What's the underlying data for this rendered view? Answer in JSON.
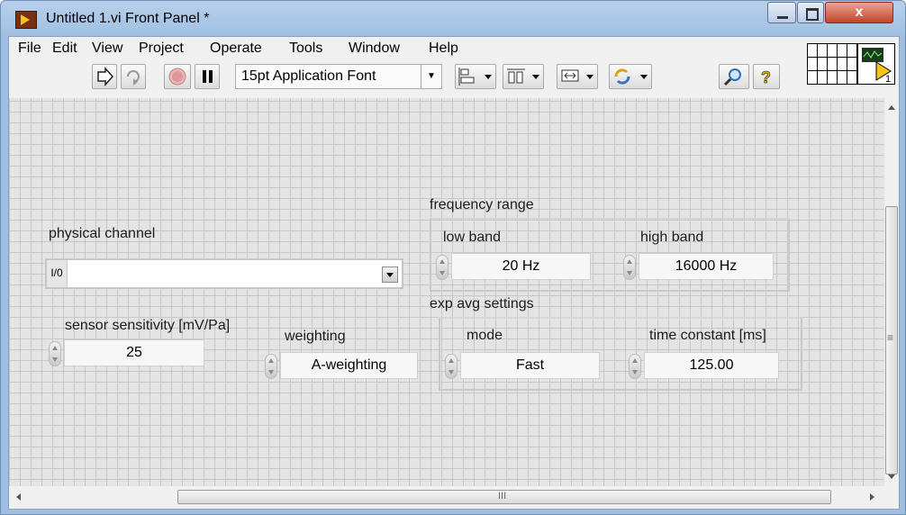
{
  "window": {
    "title": "Untitled 1.vi Front Panel *",
    "close_glyph": "x"
  },
  "menu": [
    "File",
    "Edit",
    "View",
    "Project",
    "Operate",
    "Tools",
    "Window",
    "Help"
  ],
  "toolbar": {
    "font": "15pt Application Font",
    "icons": [
      "run-arrow-icon",
      "run-continuously-icon",
      "abort-icon",
      "pause-icon",
      "align-icon",
      "distribute-icon",
      "resize-icon",
      "reorder-icon",
      "search-icon",
      "help-icon"
    ],
    "connector_number": "1"
  },
  "panel": {
    "physical_channel": {
      "label": "physical channel",
      "io_glyph": "I/0",
      "value": ""
    },
    "sensor_sensitivity": {
      "label": "sensor sensitivity [mV/Pa]",
      "value": "25"
    },
    "weighting": {
      "label": "weighting",
      "value": "A-weighting"
    },
    "frequency_range": {
      "label": "frequency range",
      "low_band": {
        "label": "low band",
        "value": "20 Hz"
      },
      "high_band": {
        "label": "high band",
        "value": "16000 Hz"
      }
    },
    "exp_avg_settings": {
      "label": "exp avg settings",
      "mode": {
        "label": "mode",
        "value": "Fast"
      },
      "time_constant": {
        "label": "time constant [ms]",
        "value": "125.00"
      }
    }
  },
  "scrollbars": {
    "vertical_grip": "≡",
    "horizontal_grip": "III"
  }
}
